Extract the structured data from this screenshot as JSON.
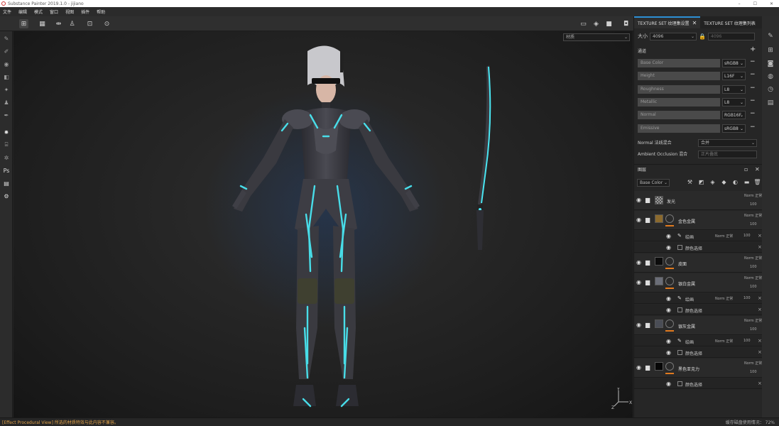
{
  "titlebar": {
    "title": "Substance Painter 2019.1.0 - jijiano",
    "min": "–",
    "max": "☐",
    "close": "✕"
  },
  "menu": [
    "文件",
    "编辑",
    "模式",
    "窗口",
    "视图",
    "插件",
    "帮助"
  ],
  "viewport": {
    "material_mode": "材质",
    "axis_y": "Y",
    "axis_z": "Z",
    "axis_x": "X"
  },
  "texture_set": {
    "tab_settings": "TEXTURE SET 纹理集设置",
    "tab_list": "TEXTURE SET 纹理集列表",
    "size_label": "大小",
    "size_value": "4096",
    "size_value2": "4096",
    "channels_label": "通道",
    "channels": [
      {
        "name": "Base Color",
        "format": "sRGB8"
      },
      {
        "name": "Height",
        "format": "L16F"
      },
      {
        "name": "Roughness",
        "format": "L8"
      },
      {
        "name": "Metallic",
        "format": "L8"
      },
      {
        "name": "Normal",
        "format": "RGB16F"
      },
      {
        "name": "Emissive",
        "format": "sRGB8"
      }
    ],
    "normal_mix_label": "Normal 法线混合",
    "normal_mix_value": "合并",
    "ao_mix_label": "Ambient Occlusion 混合",
    "ao_mix_value": "正片叠底"
  },
  "layers": {
    "title": "图层",
    "channel": "Base Color",
    "items": [
      {
        "name": "发光",
        "blend": "Norm 正常",
        "opacity": "100",
        "subs": []
      },
      {
        "name": "金色金属",
        "blend": "Norm 正常",
        "opacity": "100",
        "subs": [
          {
            "name": "绘画",
            "blend": "Norm 正常",
            "opacity": "100"
          },
          {
            "name": "颜色选择"
          }
        ]
      },
      {
        "name": "皮面",
        "blend": "Norm 正常",
        "opacity": "100",
        "subs": []
      },
      {
        "name": "银白金属",
        "blend": "Norm 正常",
        "opacity": "100",
        "subs": [
          {
            "name": "绘画",
            "blend": "Norm 正常",
            "opacity": "100"
          },
          {
            "name": "颜色选择"
          }
        ]
      },
      {
        "name": "银灰金属",
        "blend": "Norm 正常",
        "opacity": "100",
        "subs": [
          {
            "name": "绘画",
            "blend": "Norm 正常",
            "opacity": "100"
          },
          {
            "name": "颜色选择"
          }
        ]
      },
      {
        "name": "黑色亚克力",
        "blend": "Norm 正常",
        "opacity": "100",
        "subs": [
          {
            "name": "颜色选择"
          }
        ]
      }
    ]
  },
  "status": {
    "left": "[Effect Procedural View] 所选的材质特效与此内容不兼容。",
    "right": "缓存磁盘使用情况： 72%"
  },
  "colors": {
    "accent": "#2d8fd5",
    "mask_orange": "#e07a1f",
    "glow_cyan": "#49e6f2"
  }
}
